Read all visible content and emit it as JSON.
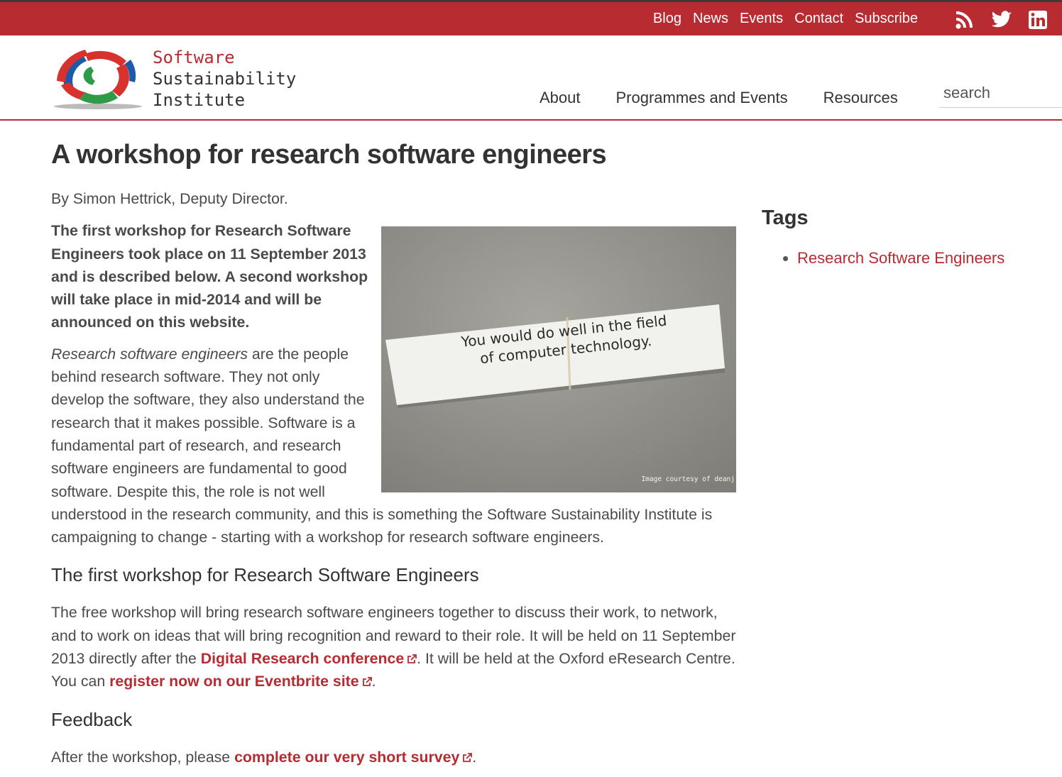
{
  "topbar": {
    "links": [
      "Blog",
      "News",
      "Events",
      "Contact",
      "Subscribe"
    ],
    "social_icons": [
      "rss-icon",
      "twitter-icon",
      "linkedin-icon"
    ]
  },
  "logo": {
    "line1": "Software",
    "line2": "Sustainability",
    "line3": "Institute"
  },
  "nav": {
    "items": [
      "About",
      "Programmes and Events",
      "Resources"
    ]
  },
  "search": {
    "placeholder": "search"
  },
  "article": {
    "title": "A workshop for research software engineers",
    "byline": "By Simon Hettrick, Deputy Director.",
    "intro_bold": "The first workshop for Research Software Engineers took place on 11 September 2013 and is described below. A second workshop will take place in mid-2014 and will be announced on this website.",
    "p1_em": "Research software engineers",
    "p1_rest": " are the people behind research software. They not only develop the software, they also understand the research that it makes possible. Software is a fundamental part of research, and research software engineers are fundamental to good software. Despite this, the role is not well understood in the research community, and this is something the Software Sustainability Institute is campaigning to change - starting with a workshop for research software engineers.",
    "image_text_line1": "You would do well in the field",
    "image_text_line2": "of computer technology.",
    "image_credit": "Image courtesy of deanj",
    "h2_first": "The first workshop for Research Software Engineers",
    "p2_a": "The free workshop will bring research software engineers together to discuss their work, to network, and to work on ideas that will bring recognition and reward to their role. It will be held on 11 September 2013 directly after the ",
    "p2_link1": "Digital Research conference",
    "p2_b": ". It will be held at the Oxford eResearch Centre. You can ",
    "p2_link2": "register now on our Eventbrite site",
    "p2_c": ".",
    "h2_feedback": "Feedback",
    "p3_a": "After the workshop, please ",
    "p3_link": "complete our very short survey",
    "p3_b": "."
  },
  "sidebar": {
    "title": "Tags",
    "tags": [
      "Research Software Engineers"
    ]
  },
  "colors": {
    "brand_red": "#b72b31",
    "text": "#4a4a4a"
  }
}
